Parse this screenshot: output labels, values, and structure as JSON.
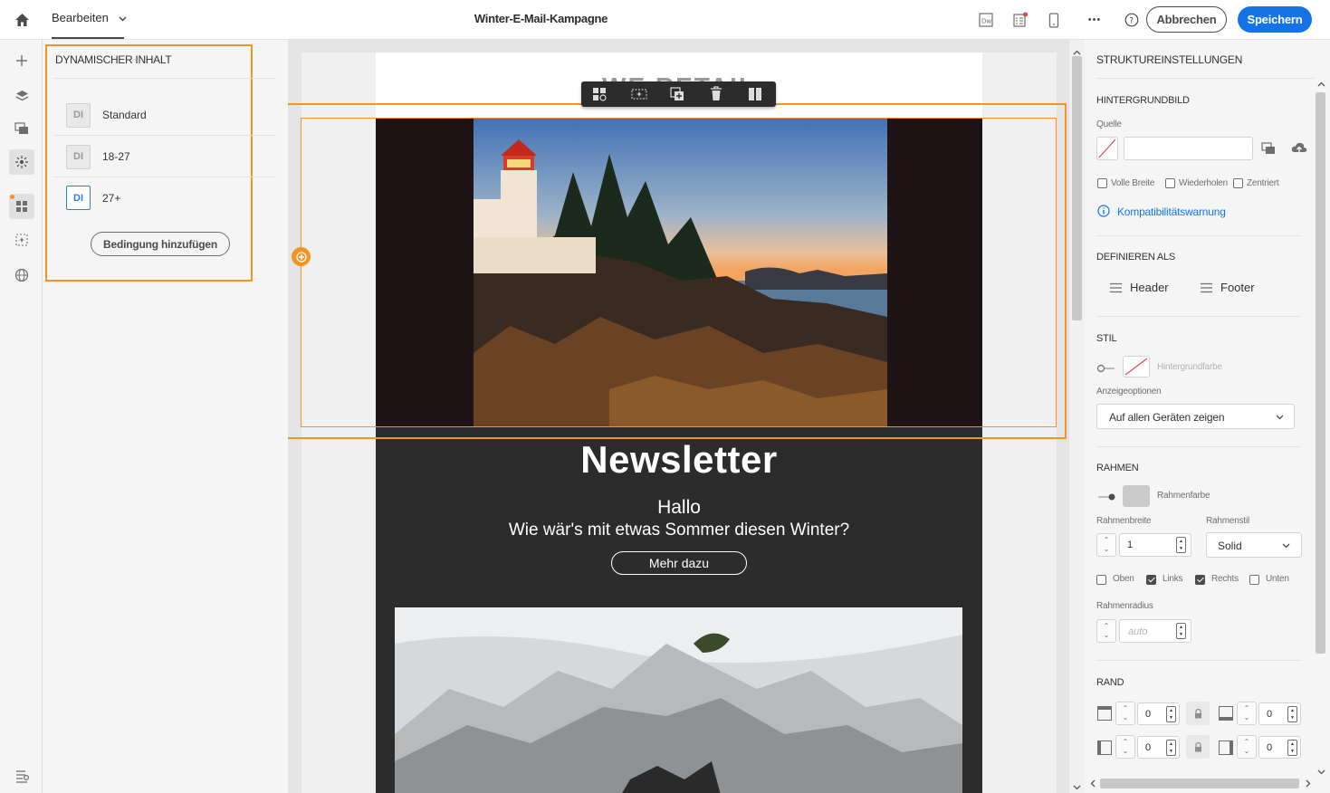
{
  "topbar": {
    "mode_label": "Bearbeiten",
    "title": "Winter-E-Mail-Kampagne",
    "more_label": "•••",
    "cancel_label": "Abbrechen",
    "save_label": "Speichern",
    "accent_color": "#1473e6"
  },
  "left_panel": {
    "title": "DYNAMISCHER INHALT",
    "items": [
      {
        "badge": "DI",
        "label": "Standard"
      },
      {
        "badge": "DI",
        "label": "18-27"
      },
      {
        "badge": "DI",
        "label": "27+"
      }
    ],
    "add_condition_label": "Bedingung hinzufügen"
  },
  "email": {
    "brand_partial": "WE RETAIL",
    "newsletter_title": "Newsletter",
    "greeting": "Hallo",
    "subtitle": "Wie wär's mit etwas Sommer diesen Winter?",
    "cta_label": "Mehr dazu",
    "highlight_color": "#f29423"
  },
  "right_panel": {
    "title": "STRUKTUREINSTELLUNGEN",
    "background_image": {
      "heading": "HINTERGRUNDBILD",
      "source_label": "Quelle",
      "options": [
        "Volle Breite",
        "Wiederholen",
        "Zentriert"
      ],
      "compat_warning": "Kompatibilitätswarnung"
    },
    "define_as": {
      "heading": "DEFINIEREN ALS",
      "header_label": "Header",
      "footer_label": "Footer"
    },
    "style": {
      "heading": "STIL",
      "bg_color_label": "Hintergrundfarbe",
      "display_options_label": "Anzeigeoptionen",
      "display_options_value": "Auf allen Geräten zeigen"
    },
    "border": {
      "heading": "RAHMEN",
      "color_label": "Rahmenfarbe",
      "width_label": "Rahmenbreite",
      "width_value": "1",
      "style_label": "Rahmenstil",
      "style_value": "Solid",
      "sides": [
        {
          "label": "Oben",
          "checked": false
        },
        {
          "label": "Links",
          "checked": true
        },
        {
          "label": "Rechts",
          "checked": true
        },
        {
          "label": "Unten",
          "checked": false
        }
      ],
      "radius_label": "Rahmenradius",
      "radius_placeholder": "auto"
    },
    "margin": {
      "heading": "RAND",
      "values": [
        "0",
        "0",
        "0",
        "0"
      ]
    }
  }
}
